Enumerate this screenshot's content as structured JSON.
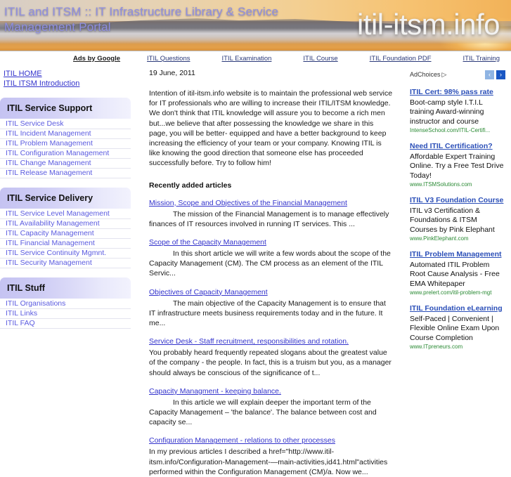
{
  "banner": {
    "title": "ITIL and ITSM :: IT Infrastructure Library & Service Management Portal",
    "domain": "itil-itsm.info"
  },
  "adsbar": {
    "label": "Ads by Google",
    "links": [
      "ITIL Questions",
      "ITIL Examination",
      "ITIL Course",
      "ITIL Foundation PDF",
      "ITIL Training"
    ]
  },
  "sidebar": {
    "top_links": [
      "ITIL HOME",
      "ITIL ITSM Introduction"
    ],
    "blocks": [
      {
        "header": "ITIL Service Support",
        "items": [
          "ITIL Service Desk",
          "ITIL Incident Management",
          "ITIL Problem Management",
          "ITIL Configuration Management",
          "ITIL Change Management",
          "ITIL Release Management"
        ]
      },
      {
        "header": "ITIL Service Delivery",
        "items": [
          "ITIL Service Level Management",
          "ITIL Availability Management",
          "ITIL Capacity Management",
          "ITIL Financial Management",
          "ITIL Service Continuity Mgmnt.",
          "ITIL Security Management"
        ]
      },
      {
        "header": "ITIL Stuff",
        "items": [
          "ITIL Organisations",
          "ITIL Links",
          "ITIL FAQ"
        ]
      }
    ]
  },
  "main": {
    "date": "19 June, 2011",
    "intro": "Intention of itil-itsm.info website is to maintain the professional web service for IT professionals who are willing to increase their ITIL/ITSM knowledge. We don't think that ITIL knowledge will assure you to become a rich men but...we believe that after possessing the knowledge we share in this page, you will be better- equipped and have a better background to keep increasing the efficiency of your team or your company. Knowing ITIL is like knowing the good direction that someone else has proceeded successfully before. Try to follow him!",
    "section_title": "Recently added articles",
    "articles": [
      {
        "title": "Mission, Scope and Objectives of the Financial Management",
        "indent": true,
        "text": "The mission of the Financial Management is to manage effectively finances of IT resources involved in running IT services. This ..."
      },
      {
        "title": "Scope of the Capacity Management",
        "indent": true,
        "text": "In this short article we will write a few words about the scope of the Capacity Management (CM). The CM process as an element of the ITIL Servic..."
      },
      {
        "title": "Objectives of Capacity Management",
        "indent": true,
        "text": "The main objective of the Capacity Management is to ensure that IT infrastructure meets business requirements today and in the future. It me..."
      },
      {
        "title": "Service Desk - Staff recruitment, responsibilities and rotation.",
        "indent": false,
        "text": "You probably heard frequently repeated slogans about the greatest value of the company - the people. In fact, this is a truism but you, as a manager should always be conscious of the significance of t..."
      },
      {
        "title": "Capacity Managment - keeping balance.",
        "indent": true,
        "text": "In this article we will explain deeper the important term of the Capacity Management – 'the balance'. The balance between cost and capacity se..."
      },
      {
        "title": "Configuration Management - relations to other processes",
        "indent": false,
        "text": "In my previous articles I described a href=\"http://www.itil-itsm.info/Configuration-Management-—main-activities,id41.html\"activities performed within the Configuration Management (CM)/a. Now we..."
      }
    ]
  },
  "rail": {
    "adchoices_label": "AdChoices",
    "adchoices_glyph": "▷",
    "prev_glyph": "‹",
    "next_glyph": "›",
    "ads": [
      {
        "title": "ITIL Cert: 98% pass rate",
        "body": "Boot-camp style I.T.I.L training Award-winning instructor and course",
        "url": "IntenseSchool.com/ITIL-Certifi..."
      },
      {
        "title": "Need ITIL Certification?",
        "body": "Affordable Expert Training Online. Try a Free Test Drive Today!",
        "url": "www.ITSMSolutions.com"
      },
      {
        "title": "ITIL V3 Foundation Course",
        "body": "ITIL v3 Certification & Foundations & ITSM Courses by Pink Elephant",
        "url": "www.PinkElephant.com"
      },
      {
        "title": "ITIL Problem Management",
        "body": "Automated ITIL Problem Root Cause Analysis - Free EMA Whitepaper",
        "url": "www.prelert.com/itil-problem-mgt"
      },
      {
        "title": "ITIL Foundation eLearning",
        "body": "Self-Paced | Convenient | Flexible Online Exam Upon Course Completion",
        "url": "www.ITpreneurs.com"
      }
    ]
  }
}
